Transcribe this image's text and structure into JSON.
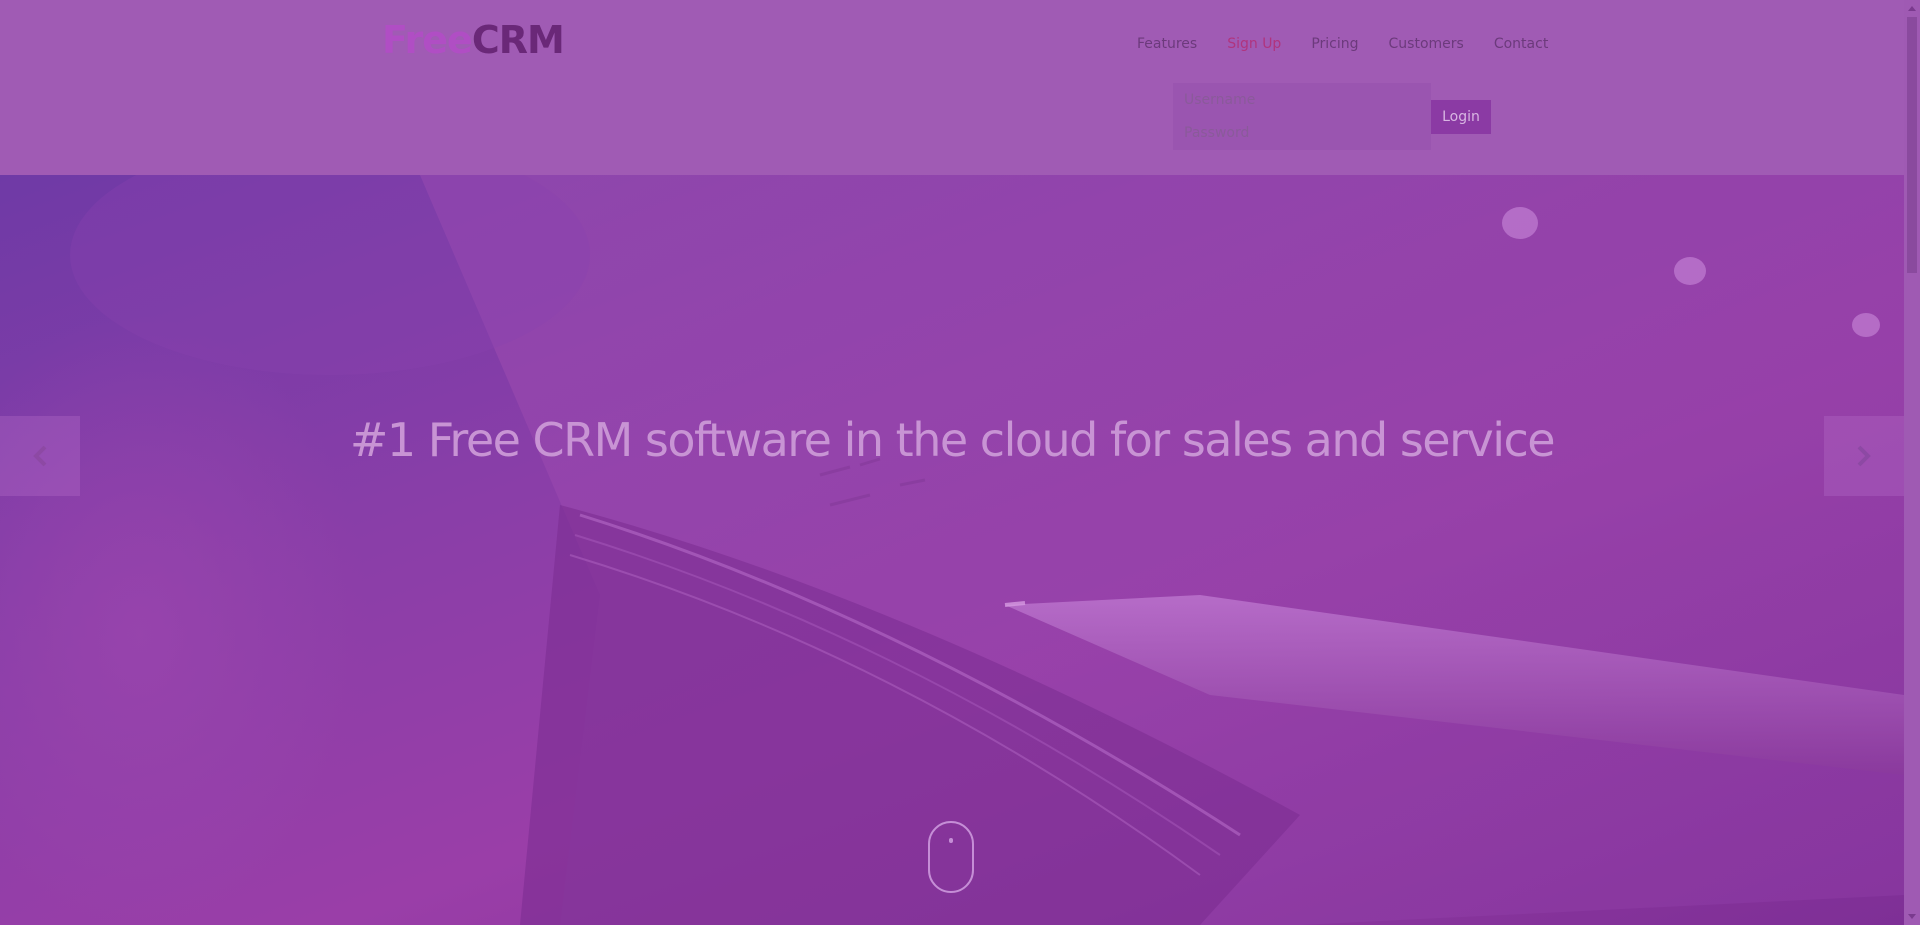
{
  "logo": {
    "part1": "Free",
    "part2": "CRM"
  },
  "nav": {
    "items": [
      {
        "label": "Features"
      },
      {
        "label": "Sign Up"
      },
      {
        "label": "Pricing"
      },
      {
        "label": "Customers"
      },
      {
        "label": "Contact"
      }
    ]
  },
  "login": {
    "username_placeholder": "Username",
    "password_placeholder": "Password",
    "button_label": "Login"
  },
  "hero": {
    "headline": "#1 Free CRM software in the cloud for sales and service"
  },
  "colors": {
    "header_bg": "#a05bb4",
    "logo_free": "#b04ec4",
    "logo_crm": "#6a2878",
    "nav_active": "#b0347e",
    "login_button": "#8b3aa4"
  },
  "icons": {
    "carousel_prev": "chevron-left-icon",
    "carousel_next": "chevron-right-icon",
    "scroll_down": "mouse-icon"
  }
}
